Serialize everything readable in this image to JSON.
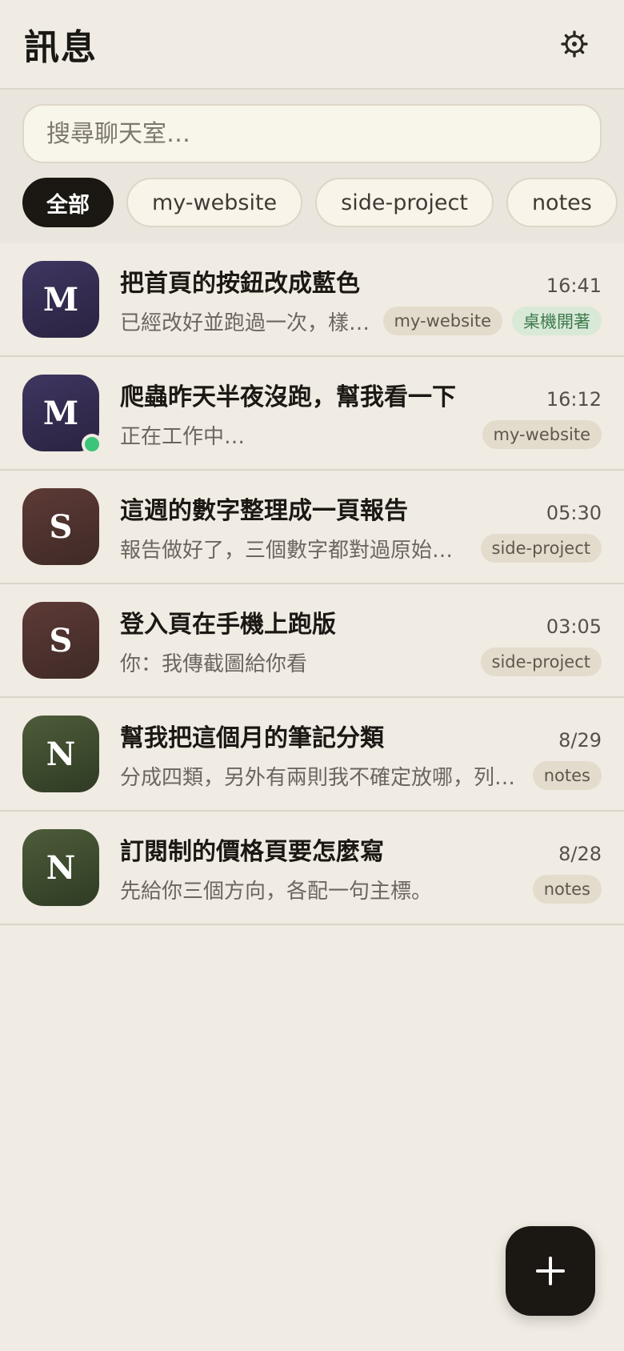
{
  "header": {
    "title": "訊息",
    "settings_icon": "gear-icon"
  },
  "search": {
    "placeholder": "搜尋聊天室…",
    "value": ""
  },
  "filters": [
    {
      "label": "全部",
      "active": true
    },
    {
      "label": "my-website",
      "active": false
    },
    {
      "label": "side-project",
      "active": false
    },
    {
      "label": "notes",
      "active": false
    }
  ],
  "chats": [
    {
      "avatar": "M",
      "title": "把首頁的按鈕改成藍色",
      "time": "16:41",
      "preview": "已經改好並跑過一次，樣式檢查都通過了。",
      "tags": [
        "my-website",
        "桌機開著"
      ],
      "online": false
    },
    {
      "avatar": "M",
      "title": "爬蟲昨天半夜沒跑，幫我看一下",
      "time": "16:12",
      "preview": "正在工作中…",
      "tags": [
        "my-website"
      ],
      "online": true
    },
    {
      "avatar": "S",
      "title": "這週的數字整理成一頁報告",
      "time": "05:30",
      "preview": "報告做好了，三個數字都對過原始檔。",
      "tags": [
        "side-project"
      ],
      "online": false
    },
    {
      "avatar": "S",
      "title": "登入頁在手機上跑版",
      "time": "03:05",
      "preview": "你：我傳截圖給你看",
      "tags": [
        "side-project"
      ],
      "online": false
    },
    {
      "avatar": "N",
      "title": "幫我把這個月的筆記分類",
      "time": "8/29",
      "preview": "分成四類，另外有兩則我不確定放哪，列出來給你決定。",
      "tags": [
        "notes"
      ],
      "online": false
    },
    {
      "avatar": "N",
      "title": "訂閱制的價格頁要怎麼寫",
      "time": "8/28",
      "preview": "先給你三個方向，各配一句主標。",
      "tags": [
        "notes"
      ],
      "online": false
    }
  ],
  "fab": {
    "icon": "plus-icon",
    "label": "+"
  },
  "colors": {
    "background": "#f0ebe3",
    "accent_dark": "#1b1712",
    "online": "#3bc47a",
    "avatar_m": "#3e3660",
    "avatar_s": "#5d3a36",
    "avatar_n": "#4e5c3a"
  }
}
